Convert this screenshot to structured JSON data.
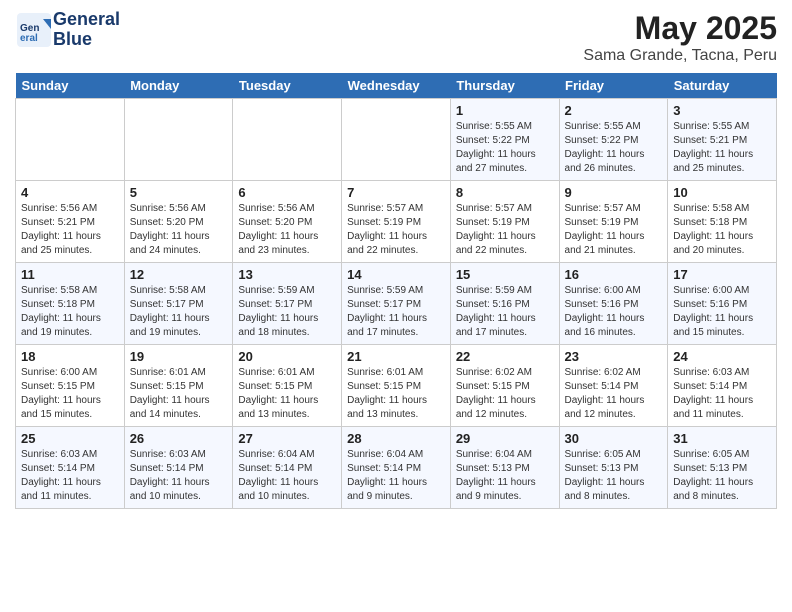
{
  "logo": {
    "line1": "General",
    "line2": "Blue"
  },
  "title": "May 2025",
  "subtitle": "Sama Grande, Tacna, Peru",
  "days_of_week": [
    "Sunday",
    "Monday",
    "Tuesday",
    "Wednesday",
    "Thursday",
    "Friday",
    "Saturday"
  ],
  "weeks": [
    [
      {
        "num": "",
        "content": ""
      },
      {
        "num": "",
        "content": ""
      },
      {
        "num": "",
        "content": ""
      },
      {
        "num": "",
        "content": ""
      },
      {
        "num": "1",
        "content": "Sunrise: 5:55 AM\nSunset: 5:22 PM\nDaylight: 11 hours\nand 27 minutes."
      },
      {
        "num": "2",
        "content": "Sunrise: 5:55 AM\nSunset: 5:22 PM\nDaylight: 11 hours\nand 26 minutes."
      },
      {
        "num": "3",
        "content": "Sunrise: 5:55 AM\nSunset: 5:21 PM\nDaylight: 11 hours\nand 25 minutes."
      }
    ],
    [
      {
        "num": "4",
        "content": "Sunrise: 5:56 AM\nSunset: 5:21 PM\nDaylight: 11 hours\nand 25 minutes."
      },
      {
        "num": "5",
        "content": "Sunrise: 5:56 AM\nSunset: 5:20 PM\nDaylight: 11 hours\nand 24 minutes."
      },
      {
        "num": "6",
        "content": "Sunrise: 5:56 AM\nSunset: 5:20 PM\nDaylight: 11 hours\nand 23 minutes."
      },
      {
        "num": "7",
        "content": "Sunrise: 5:57 AM\nSunset: 5:19 PM\nDaylight: 11 hours\nand 22 minutes."
      },
      {
        "num": "8",
        "content": "Sunrise: 5:57 AM\nSunset: 5:19 PM\nDaylight: 11 hours\nand 22 minutes."
      },
      {
        "num": "9",
        "content": "Sunrise: 5:57 AM\nSunset: 5:19 PM\nDaylight: 11 hours\nand 21 minutes."
      },
      {
        "num": "10",
        "content": "Sunrise: 5:58 AM\nSunset: 5:18 PM\nDaylight: 11 hours\nand 20 minutes."
      }
    ],
    [
      {
        "num": "11",
        "content": "Sunrise: 5:58 AM\nSunset: 5:18 PM\nDaylight: 11 hours\nand 19 minutes."
      },
      {
        "num": "12",
        "content": "Sunrise: 5:58 AM\nSunset: 5:17 PM\nDaylight: 11 hours\nand 19 minutes."
      },
      {
        "num": "13",
        "content": "Sunrise: 5:59 AM\nSunset: 5:17 PM\nDaylight: 11 hours\nand 18 minutes."
      },
      {
        "num": "14",
        "content": "Sunrise: 5:59 AM\nSunset: 5:17 PM\nDaylight: 11 hours\nand 17 minutes."
      },
      {
        "num": "15",
        "content": "Sunrise: 5:59 AM\nSunset: 5:16 PM\nDaylight: 11 hours\nand 17 minutes."
      },
      {
        "num": "16",
        "content": "Sunrise: 6:00 AM\nSunset: 5:16 PM\nDaylight: 11 hours\nand 16 minutes."
      },
      {
        "num": "17",
        "content": "Sunrise: 6:00 AM\nSunset: 5:16 PM\nDaylight: 11 hours\nand 15 minutes."
      }
    ],
    [
      {
        "num": "18",
        "content": "Sunrise: 6:00 AM\nSunset: 5:15 PM\nDaylight: 11 hours\nand 15 minutes."
      },
      {
        "num": "19",
        "content": "Sunrise: 6:01 AM\nSunset: 5:15 PM\nDaylight: 11 hours\nand 14 minutes."
      },
      {
        "num": "20",
        "content": "Sunrise: 6:01 AM\nSunset: 5:15 PM\nDaylight: 11 hours\nand 13 minutes."
      },
      {
        "num": "21",
        "content": "Sunrise: 6:01 AM\nSunset: 5:15 PM\nDaylight: 11 hours\nand 13 minutes."
      },
      {
        "num": "22",
        "content": "Sunrise: 6:02 AM\nSunset: 5:15 PM\nDaylight: 11 hours\nand 12 minutes."
      },
      {
        "num": "23",
        "content": "Sunrise: 6:02 AM\nSunset: 5:14 PM\nDaylight: 11 hours\nand 12 minutes."
      },
      {
        "num": "24",
        "content": "Sunrise: 6:03 AM\nSunset: 5:14 PM\nDaylight: 11 hours\nand 11 minutes."
      }
    ],
    [
      {
        "num": "25",
        "content": "Sunrise: 6:03 AM\nSunset: 5:14 PM\nDaylight: 11 hours\nand 11 minutes."
      },
      {
        "num": "26",
        "content": "Sunrise: 6:03 AM\nSunset: 5:14 PM\nDaylight: 11 hours\nand 10 minutes."
      },
      {
        "num": "27",
        "content": "Sunrise: 6:04 AM\nSunset: 5:14 PM\nDaylight: 11 hours\nand 10 minutes."
      },
      {
        "num": "28",
        "content": "Sunrise: 6:04 AM\nSunset: 5:14 PM\nDaylight: 11 hours\nand 9 minutes."
      },
      {
        "num": "29",
        "content": "Sunrise: 6:04 AM\nSunset: 5:13 PM\nDaylight: 11 hours\nand 9 minutes."
      },
      {
        "num": "30",
        "content": "Sunrise: 6:05 AM\nSunset: 5:13 PM\nDaylight: 11 hours\nand 8 minutes."
      },
      {
        "num": "31",
        "content": "Sunrise: 6:05 AM\nSunset: 5:13 PM\nDaylight: 11 hours\nand 8 minutes."
      }
    ]
  ]
}
